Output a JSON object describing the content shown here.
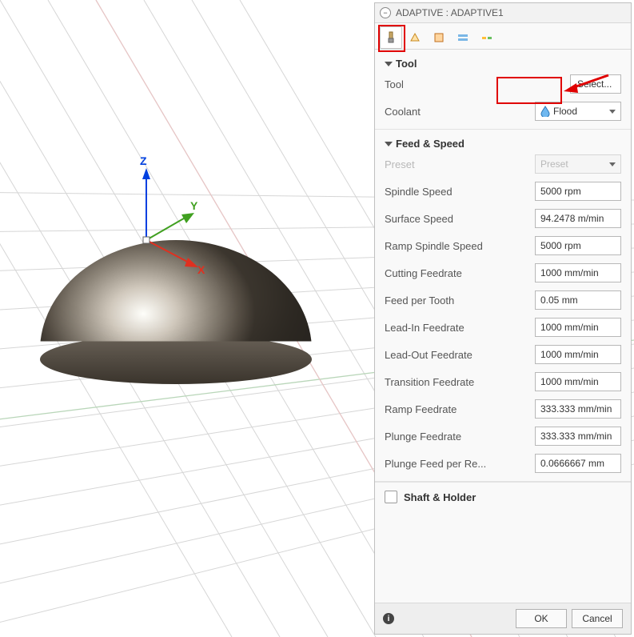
{
  "panel": {
    "title": "ADAPTIVE : ADAPTIVE1"
  },
  "tabs": {
    "items": [
      {
        "name": "tool-tab",
        "active": true
      },
      {
        "name": "geometry-tab",
        "active": false
      },
      {
        "name": "heights-tab",
        "active": false
      },
      {
        "name": "passes-tab",
        "active": false
      },
      {
        "name": "linking-tab",
        "active": false
      }
    ]
  },
  "tool_section": {
    "title": "Tool",
    "tool_label": "Tool",
    "tool_button": "Select...",
    "coolant_label": "Coolant",
    "coolant_value": "Flood"
  },
  "feed_section": {
    "title": "Feed & Speed",
    "preset_label": "Preset",
    "preset_value": "Preset",
    "rows": [
      {
        "label": "Spindle Speed",
        "value": "5000 rpm"
      },
      {
        "label": "Surface Speed",
        "value": "94.2478 m/min"
      },
      {
        "label": "Ramp Spindle Speed",
        "value": "5000 rpm"
      },
      {
        "label": "Cutting Feedrate",
        "value": "1000 mm/min"
      },
      {
        "label": "Feed per Tooth",
        "value": "0.05 mm"
      },
      {
        "label": "Lead-In Feedrate",
        "value": "1000 mm/min"
      },
      {
        "label": "Lead-Out Feedrate",
        "value": "1000 mm/min"
      },
      {
        "label": "Transition Feedrate",
        "value": "1000 mm/min"
      },
      {
        "label": "Ramp Feedrate",
        "value": "333.333 mm/min"
      },
      {
        "label": "Plunge Feedrate",
        "value": "333.333 mm/min"
      },
      {
        "label": "Plunge Feed per Re...",
        "value": "0.0666667 mm"
      }
    ]
  },
  "shaft_section": {
    "title": "Shaft & Holder"
  },
  "footer": {
    "ok": "OK",
    "cancel": "Cancel"
  },
  "axes": {
    "z": "Z",
    "x": "X",
    "y": "Y"
  }
}
